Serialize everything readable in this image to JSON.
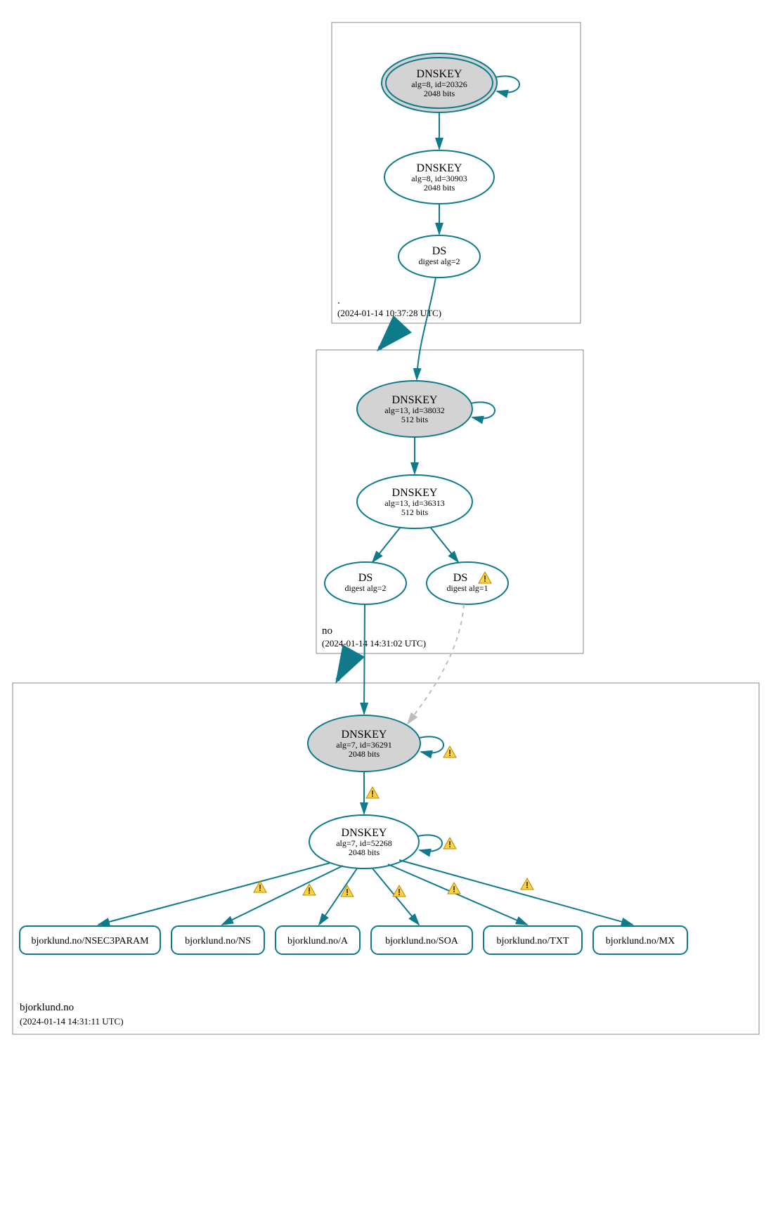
{
  "zones": {
    "root": {
      "name": ".",
      "timestamp": "(2024-01-14 10:37:28 UTC)"
    },
    "no": {
      "name": "no",
      "timestamp": "(2024-01-14 14:31:02 UTC)"
    },
    "domain": {
      "name": "bjorklund.no",
      "timestamp": "(2024-01-14 14:31:11 UTC)"
    }
  },
  "nodes": {
    "root_ksk": {
      "title": "DNSKEY",
      "line2": "alg=8, id=20326",
      "line3": "2048 bits"
    },
    "root_zsk": {
      "title": "DNSKEY",
      "line2": "alg=8, id=30903",
      "line3": "2048 bits"
    },
    "root_ds": {
      "title": "DS",
      "line2": "digest alg=2"
    },
    "no_ksk": {
      "title": "DNSKEY",
      "line2": "alg=13, id=38032",
      "line3": "512 bits"
    },
    "no_zsk": {
      "title": "DNSKEY",
      "line2": "alg=13, id=36313",
      "line3": "512 bits"
    },
    "no_ds1": {
      "title": "DS",
      "line2": "digest alg=2"
    },
    "no_ds2": {
      "title": "DS",
      "line2": "digest alg=1"
    },
    "dom_ksk": {
      "title": "DNSKEY",
      "line2": "alg=7, id=36291",
      "line3": "2048 bits"
    },
    "dom_zsk": {
      "title": "DNSKEY",
      "line2": "alg=7, id=52268",
      "line3": "2048 bits"
    }
  },
  "records": {
    "r1": "bjorklund.no/NSEC3PARAM",
    "r2": "bjorklund.no/NS",
    "r3": "bjorklund.no/A",
    "r4": "bjorklund.no/SOA",
    "r5": "bjorklund.no/TXT",
    "r6": "bjorklund.no/MX"
  }
}
